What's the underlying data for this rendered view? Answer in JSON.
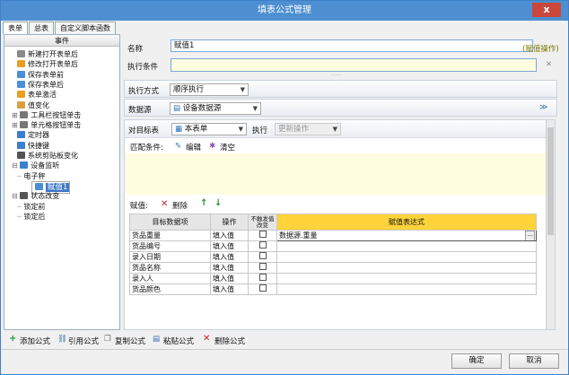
{
  "window": {
    "title": "填表公式管理",
    "close": "x"
  },
  "tabs": [
    "表单",
    "总表",
    "自定义脚本函数"
  ],
  "left": {
    "header": "事件",
    "items": [
      {
        "label": "新建打开表单后",
        "color": "#8a8a8a"
      },
      {
        "label": "修改打开表单后",
        "color": "#e8a020"
      },
      {
        "label": "保存表单前",
        "color": "#4a8fd8"
      },
      {
        "label": "保存表单后",
        "color": "#4a8fd8"
      },
      {
        "label": "表单激活",
        "color": "#e8a020"
      },
      {
        "label": "值变化",
        "color": "#d8a040"
      },
      {
        "label": "工具栏按钮单击",
        "color": "#777"
      },
      {
        "label": "单元格按钮单击",
        "color": "#777"
      },
      {
        "label": "定时器",
        "color": "#3a7fd0"
      },
      {
        "label": "快捷键",
        "color": "#3a7fd0"
      },
      {
        "label": "系统剪贴板变化",
        "color": "#555"
      },
      {
        "label": "设备监听",
        "color": "#3a7fd0"
      },
      {
        "label": "电子秤",
        "color": ""
      },
      {
        "label": "赋值1",
        "color": "#4a8fd8"
      },
      {
        "label": "状态改变",
        "color": "#555"
      },
      {
        "label": "锁定前",
        "color": ""
      },
      {
        "label": "锁定后",
        "color": ""
      }
    ]
  },
  "form": {
    "name_label": "名称",
    "name_value": "赋值1",
    "mode_tag": "(赋值操作)",
    "cond_label": "执行条件",
    "exec_label": "执行方式",
    "exec_value": "顺序执行",
    "ds_label": "数据源",
    "ds_value": "设备数据源",
    "target_label": "对目标表",
    "target_value": "本表单",
    "exec2_label": "执行",
    "exec2_value": "更新操作",
    "match_label": "匹配条件:",
    "edit": "编辑",
    "clear": "清空",
    "assign_label": "赋值:",
    "delete": "删除"
  },
  "grid": {
    "headers": [
      "目标数据项",
      "操作",
      "不触发值改变",
      "赋值表达式"
    ],
    "rows": [
      [
        "货品重量",
        "填入值",
        "",
        "数据源.重量"
      ],
      [
        "货品编号",
        "填入值",
        "",
        ""
      ],
      [
        "录入日期",
        "填入值",
        "",
        ""
      ],
      [
        "货品名称",
        "填入值",
        "",
        ""
      ],
      [
        "录入人",
        "填入值",
        "",
        ""
      ],
      [
        "货品颜色",
        "填入值",
        "",
        ""
      ]
    ]
  },
  "actions": [
    "添加公式",
    "引用公式",
    "复制公式",
    "粘贴公式",
    "删除公式"
  ],
  "buttons": {
    "ok": "确定",
    "cancel": "取消"
  }
}
